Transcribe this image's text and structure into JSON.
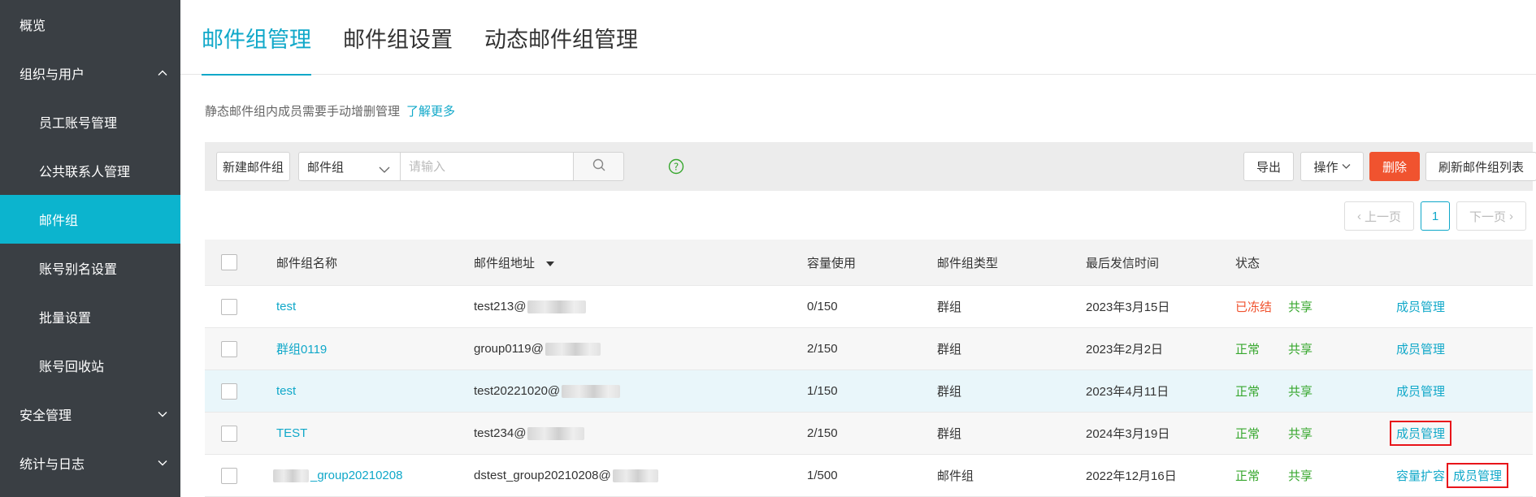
{
  "sidebar": {
    "items": [
      {
        "label": "概览"
      },
      {
        "label": "组织与用户"
      },
      {
        "label": "员工账号管理"
      },
      {
        "label": "公共联系人管理"
      },
      {
        "label": "邮件组"
      },
      {
        "label": "账号别名设置"
      },
      {
        "label": "批量设置"
      },
      {
        "label": "账号回收站"
      },
      {
        "label": "安全管理"
      },
      {
        "label": "统计与日志"
      }
    ]
  },
  "tabs": [
    {
      "label": "邮件组管理"
    },
    {
      "label": "邮件组设置"
    },
    {
      "label": "动态邮件组管理"
    }
  ],
  "notice": {
    "text": "静态邮件组内成员需要手动增删管理",
    "link": "了解更多"
  },
  "toolbar": {
    "new_label": "新建邮件组",
    "filter_value": "邮件组",
    "search_placeholder": "请输入",
    "export_label": "导出",
    "ops_label": "操作",
    "delete_label": "删除",
    "refresh_label": "刷新邮件组列表"
  },
  "pagination": {
    "prev": "上一页",
    "page": "1",
    "next": "下一页"
  },
  "table": {
    "headers": {
      "name": "邮件组名称",
      "address": "邮件组地址",
      "capacity": "容量使用",
      "type": "邮件组类型",
      "last_sent": "最后发信时间",
      "status": "状态"
    },
    "rows": [
      {
        "name": "test",
        "address": "test213@",
        "capacity": "0/150",
        "type": "群组",
        "last_sent": "2023年3月15日",
        "status": "已冻结",
        "share": "共享",
        "action": "成员管理"
      },
      {
        "name": "群组0119",
        "address": "group0119@",
        "capacity": "2/150",
        "type": "群组",
        "last_sent": "2023年2月2日",
        "status": "正常",
        "share": "共享",
        "action": "成员管理"
      },
      {
        "name": "test",
        "address": "test20221020@",
        "capacity": "1/150",
        "type": "群组",
        "last_sent": "2023年4月11日",
        "status": "正常",
        "share": "共享",
        "action": "成员管理"
      },
      {
        "name": "TEST",
        "address": "test234@",
        "capacity": "2/150",
        "type": "群组",
        "last_sent": "2024年3月19日",
        "status": "正常",
        "share": "共享",
        "action": "成员管理"
      },
      {
        "name": "_group20210208",
        "address": "dstest_group20210208@",
        "capacity": "1/500",
        "type": "邮件组",
        "last_sent": "2022年12月16日",
        "status": "正常",
        "share": "共享",
        "action_extra": "容量扩容",
        "action": "成员管理"
      }
    ]
  },
  "colors": {
    "accent": "#10a8c9",
    "sidebar_bg": "#3a3f44",
    "danger": "#f0532f",
    "ok": "#37a72e"
  }
}
